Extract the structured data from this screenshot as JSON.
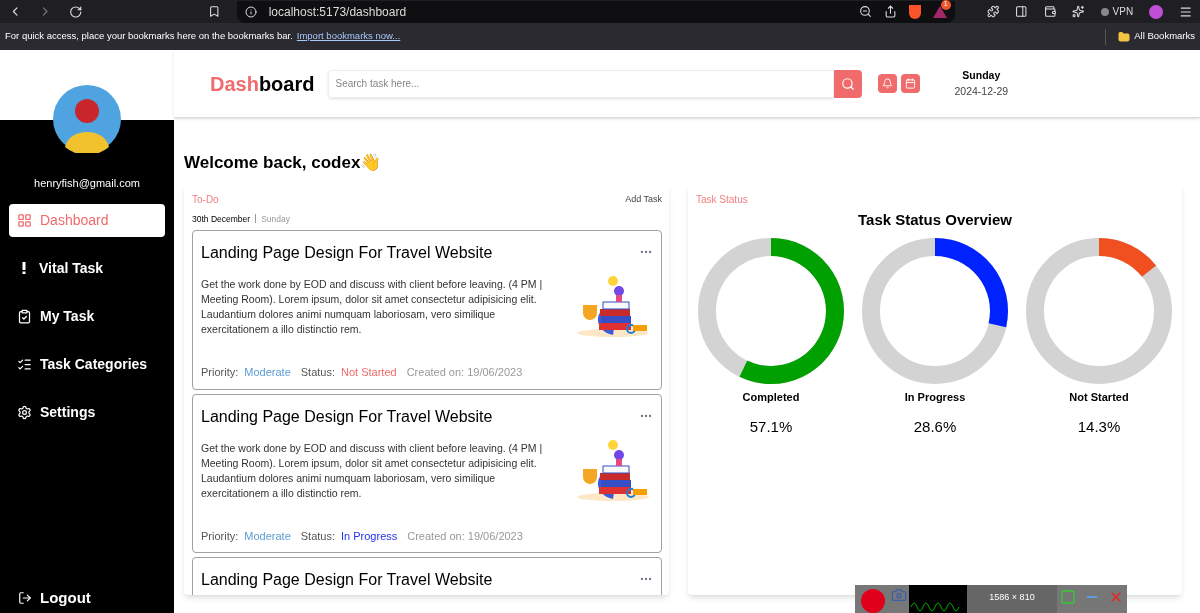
{
  "browser": {
    "url": "localhost:5173/dashboard",
    "notification_count": "1",
    "vpn_label": "VPN",
    "bookmarks_message": "For quick access, place your bookmarks here on the bookmarks bar.",
    "import_link": "Import bookmarks now...",
    "all_bookmarks": "All Bookmarks"
  },
  "header": {
    "title_accent": "Dash",
    "title_rest": "board",
    "search": {
      "placeholder": "Search task here..."
    },
    "day": "Sunday",
    "date": "2024-12-29"
  },
  "sidebar": {
    "email": "henryfish@gmail.com",
    "items": [
      {
        "label": "Dashboard",
        "kind": "grid",
        "selected": true
      },
      {
        "label": "Vital Task",
        "kind": "exclamation",
        "selected": false
      },
      {
        "label": "My Task",
        "kind": "clipboard",
        "selected": false
      },
      {
        "label": "Task Categories",
        "kind": "list",
        "selected": false
      },
      {
        "label": "Settings",
        "kind": "gear",
        "selected": false
      }
    ],
    "logout": "Logout"
  },
  "welcome": "Welcome back, codex👋",
  "todo": {
    "title": "To-Do",
    "add_task": "Add Task",
    "date": "30th December",
    "day": "Sunday",
    "tasks": [
      {
        "title": "Landing Page Design For Travel Website",
        "description": "Get the work done by EOD and discuss with client before leaving. (4 PM | Meeting Room). Lorem ipsum, dolor sit amet consectetur adipisicing elit. Laudantium dolores animi numquam laboriosam, vero similique exercitationem a illo distinctio rem.",
        "priority_label": "Priority:",
        "priority": "Moderate",
        "status_label": "Status:",
        "status": {
          "text": "Not Started",
          "color": "#f06b6b"
        },
        "created": "Created on: 19/06/2023"
      },
      {
        "title": "Landing Page Design For Travel Website",
        "description": "Get the work done by EOD and discuss with client before leaving. (4 PM | Meeting Room). Lorem ipsum, dolor sit amet consectetur adipisicing elit. Laudantium dolores animi numquam laboriosam, vero similique exercitationem a illo distinctio rem.",
        "priority_label": "Priority:",
        "priority": "Moderate",
        "status_label": "Status:",
        "status": {
          "text": "In Progress",
          "color": "#2233ee"
        },
        "created": "Created on: 19/06/2023"
      },
      {
        "title": "Landing Page Design For Travel Website"
      }
    ]
  },
  "task_status": {
    "label": "Task Status",
    "title": "Task Status Overview",
    "gauges": [
      {
        "name": "Completed",
        "reading": "57.1%",
        "color": "#00a000"
      },
      {
        "name": "In Progress",
        "reading": "28.6%",
        "color": "#0022ff"
      },
      {
        "name": "Not Started",
        "reading": "14.3%",
        "color": "#f05020"
      }
    ]
  },
  "recorder": {
    "size": "1586 × 810"
  }
}
